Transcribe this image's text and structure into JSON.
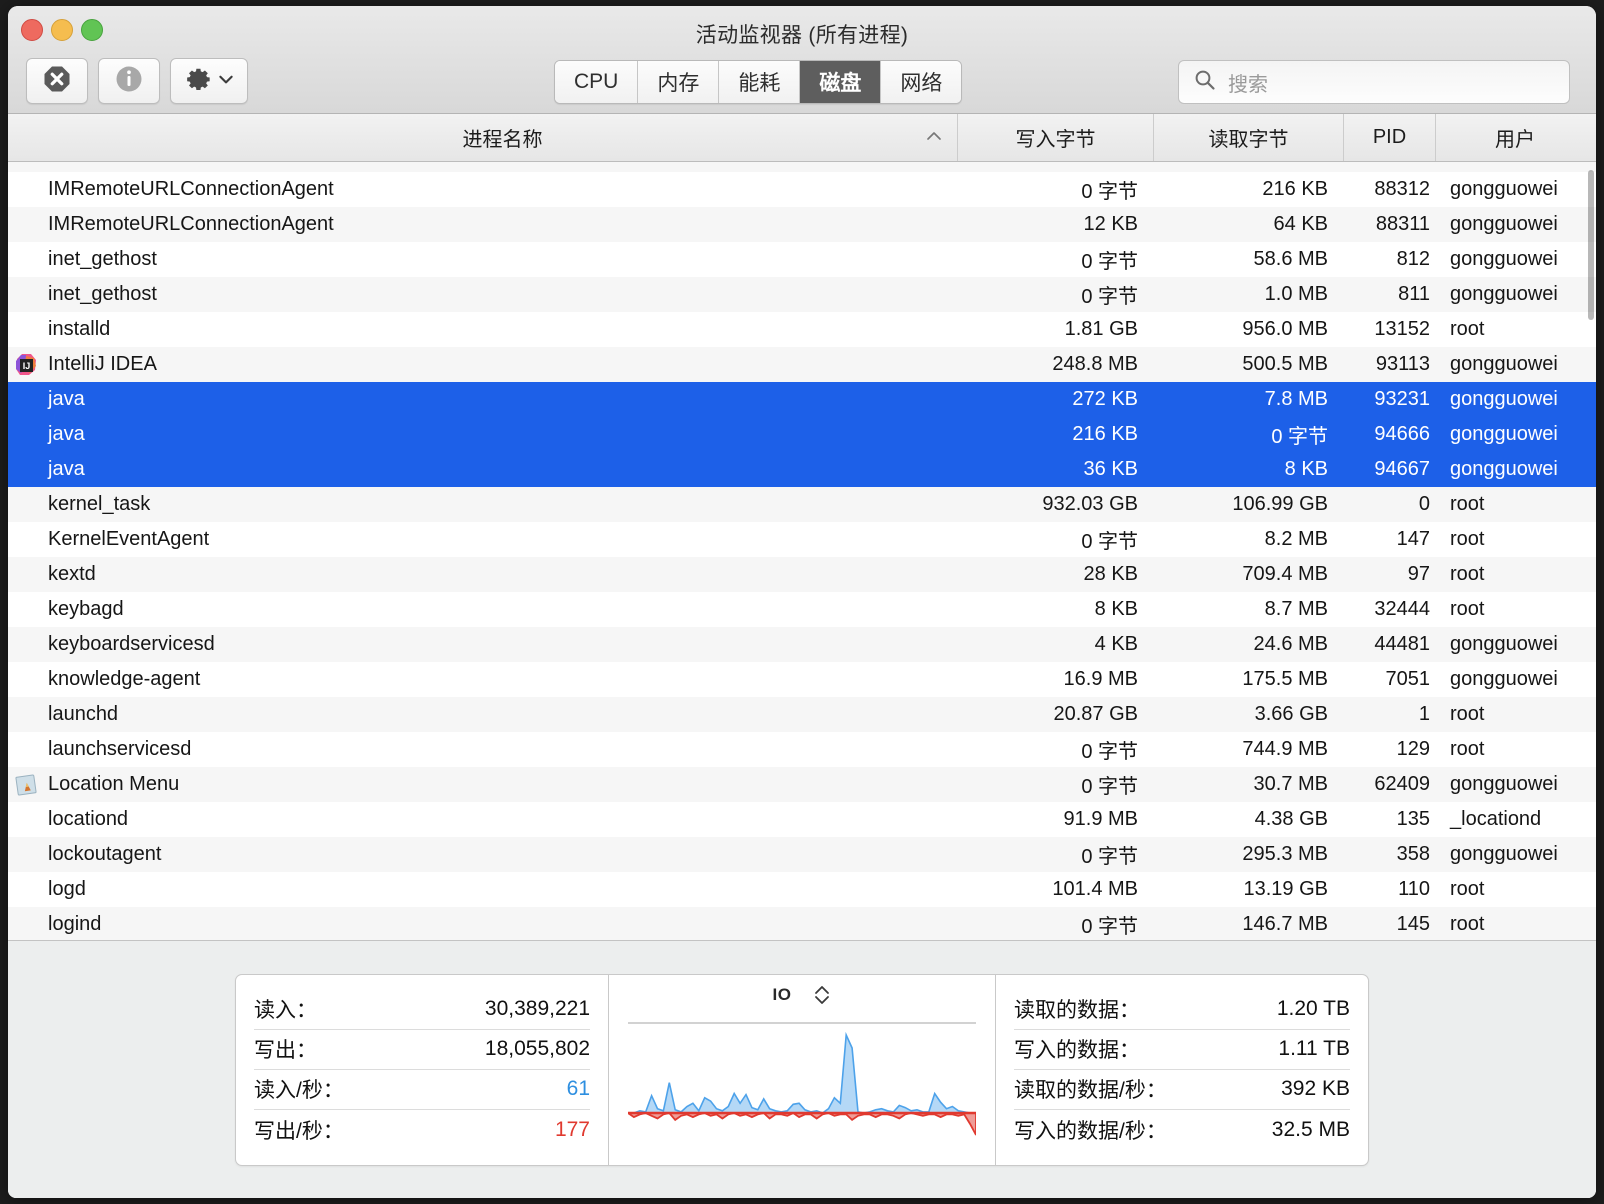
{
  "window": {
    "title": "活动监视器 (所有进程)",
    "traffic_lights": [
      "close",
      "minimize",
      "zoom"
    ]
  },
  "toolbar": {
    "stop_button_icon": "stop-octagon-x-icon",
    "info_button_icon": "info-circle-icon",
    "gear_button_icon": "gear-icon",
    "gear_chevron_icon": "chevron-down-icon",
    "tabs": [
      {
        "label": "CPU",
        "active": false
      },
      {
        "label": "内存",
        "active": false
      },
      {
        "label": "能耗",
        "active": false
      },
      {
        "label": "磁盘",
        "active": true
      },
      {
        "label": "网络",
        "active": false
      }
    ],
    "search": {
      "placeholder": "搜索",
      "value": "",
      "icon": "search-icon"
    }
  },
  "table": {
    "columns": {
      "name": "进程名称",
      "write_bytes": "写入字节",
      "read_bytes": "读取字节",
      "pid": "PID",
      "user": "用户"
    },
    "sort_column": "进程名称",
    "sort_direction": "ascending",
    "sort_icon": "chevron-up-icon",
    "rows": [
      {
        "name": "IMRemoteURLConnectionAgent",
        "write": "0 字节",
        "read": "216 KB",
        "pid": "88312",
        "user": "gongguowei",
        "selected": false,
        "icon": null
      },
      {
        "name": "IMRemoteURLConnectionAgent",
        "write": "12 KB",
        "read": "64 KB",
        "pid": "88311",
        "user": "gongguowei",
        "selected": false,
        "icon": null
      },
      {
        "name": "inet_gethost",
        "write": "0 字节",
        "read": "58.6 MB",
        "pid": "812",
        "user": "gongguowei",
        "selected": false,
        "icon": null
      },
      {
        "name": "inet_gethost",
        "write": "0 字节",
        "read": "1.0 MB",
        "pid": "811",
        "user": "gongguowei",
        "selected": false,
        "icon": null
      },
      {
        "name": "installd",
        "write": "1.81 GB",
        "read": "956.0 MB",
        "pid": "13152",
        "user": "root",
        "selected": false,
        "icon": null
      },
      {
        "name": "IntelliJ IDEA",
        "write": "248.8 MB",
        "read": "500.5 MB",
        "pid": "93113",
        "user": "gongguowei",
        "selected": false,
        "icon": "intellij-idea-app-icon"
      },
      {
        "name": "java",
        "write": "272 KB",
        "read": "7.8 MB",
        "pid": "93231",
        "user": "gongguowei",
        "selected": true,
        "icon": null
      },
      {
        "name": "java",
        "write": "216 KB",
        "read": "0 字节",
        "pid": "94666",
        "user": "gongguowei",
        "selected": true,
        "icon": null
      },
      {
        "name": "java",
        "write": "36 KB",
        "read": "8 KB",
        "pid": "94667",
        "user": "gongguowei",
        "selected": true,
        "icon": null
      },
      {
        "name": "kernel_task",
        "write": "932.03 GB",
        "read": "106.99 GB",
        "pid": "0",
        "user": "root",
        "selected": false,
        "icon": null
      },
      {
        "name": "KernelEventAgent",
        "write": "0 字节",
        "read": "8.2 MB",
        "pid": "147",
        "user": "root",
        "selected": false,
        "icon": null
      },
      {
        "name": "kextd",
        "write": "28 KB",
        "read": "709.4 MB",
        "pid": "97",
        "user": "root",
        "selected": false,
        "icon": null
      },
      {
        "name": "keybagd",
        "write": "8 KB",
        "read": "8.7 MB",
        "pid": "32444",
        "user": "root",
        "selected": false,
        "icon": null
      },
      {
        "name": "keyboardservicesd",
        "write": "4 KB",
        "read": "24.6 MB",
        "pid": "44481",
        "user": "gongguowei",
        "selected": false,
        "icon": null
      },
      {
        "name": "knowledge-agent",
        "write": "16.9 MB",
        "read": "175.5 MB",
        "pid": "7051",
        "user": "gongguowei",
        "selected": false,
        "icon": null
      },
      {
        "name": "launchd",
        "write": "20.87 GB",
        "read": "3.66 GB",
        "pid": "1",
        "user": "root",
        "selected": false,
        "icon": null
      },
      {
        "name": "launchservicesd",
        "write": "0 字节",
        "read": "744.9 MB",
        "pid": "129",
        "user": "root",
        "selected": false,
        "icon": null
      },
      {
        "name": "Location Menu",
        "write": "0 字节",
        "read": "30.7 MB",
        "pid": "62409",
        "user": "gongguowei",
        "selected": false,
        "icon": "location-menu-app-icon"
      },
      {
        "name": "locationd",
        "write": "91.9 MB",
        "read": "4.38 GB",
        "pid": "135",
        "user": "_locationd",
        "selected": false,
        "icon": null
      },
      {
        "name": "lockoutagent",
        "write": "0 字节",
        "read": "295.3 MB",
        "pid": "358",
        "user": "gongguowei",
        "selected": false,
        "icon": null
      },
      {
        "name": "logd",
        "write": "101.4 MB",
        "read": "13.19 GB",
        "pid": "110",
        "user": "root",
        "selected": false,
        "icon": null
      },
      {
        "name": "logind",
        "write": "0 字节",
        "read": "146.7 MB",
        "pid": "145",
        "user": "root",
        "selected": false,
        "icon": null
      }
    ]
  },
  "footer": {
    "left_stats": [
      {
        "label": "读入：",
        "value": "30,389,221",
        "color": "default"
      },
      {
        "label": "写出：",
        "value": "18,055,802",
        "color": "default"
      },
      {
        "label": "读入/秒：",
        "value": "61",
        "color": "blue"
      },
      {
        "label": "写出/秒：",
        "value": "177",
        "color": "red"
      }
    ],
    "right_stats": [
      {
        "label": "读取的数据：",
        "value": "1.20 TB",
        "color": "default"
      },
      {
        "label": "写入的数据：",
        "value": "1.11 TB",
        "color": "default"
      },
      {
        "label": "读取的数据/秒：",
        "value": "392 KB",
        "color": "default"
      },
      {
        "label": "写入的数据/秒：",
        "value": "32.5 MB",
        "color": "default"
      }
    ],
    "graph": {
      "title": "IO",
      "stepper_up_icon": "chevron-up-icon",
      "stepper_down_icon": "chevron-down-icon",
      "read_color": "#4da2ea",
      "write_color": "#e0392f"
    }
  },
  "chart_data": {
    "type": "area",
    "title": "IO",
    "xlabel": "",
    "ylabel": "",
    "series": [
      {
        "name": "读入/秒",
        "color": "#4da2ea",
        "values": [
          0,
          0,
          2,
          1,
          16,
          4,
          2,
          28,
          3,
          1,
          6,
          9,
          2,
          14,
          11,
          4,
          2,
          6,
          18,
          9,
          17,
          5,
          3,
          13,
          4,
          2,
          1,
          2,
          8,
          9,
          3,
          1,
          2,
          0,
          4,
          14,
          9,
          72,
          60,
          1,
          0,
          1,
          3,
          4,
          2,
          1,
          7,
          5,
          2,
          3,
          1,
          1,
          18,
          10,
          4,
          6,
          2,
          1,
          0,
          0
        ]
      },
      {
        "name": "写出/秒",
        "color": "#e0392f",
        "values": [
          0,
          -3,
          -1,
          0,
          -2,
          -4,
          -1,
          0,
          -5,
          -2,
          -1,
          -3,
          -1,
          0,
          -2,
          -1,
          -4,
          -1,
          0,
          -2,
          -1,
          -3,
          -1,
          0,
          -4,
          -1,
          -1,
          -2,
          0,
          -3,
          -1,
          -1,
          -4,
          -1,
          0,
          -2,
          -1,
          -1,
          -5,
          -2,
          -1,
          -1,
          -3,
          -1,
          -1,
          -2,
          -4,
          -1,
          0,
          -1,
          -2,
          -1,
          -1,
          -3,
          -1,
          -1,
          -2,
          -1,
          -8,
          -16
        ]
      }
    ],
    "ylim": [
      -20,
      80
    ],
    "grid": false,
    "legend": "none"
  }
}
